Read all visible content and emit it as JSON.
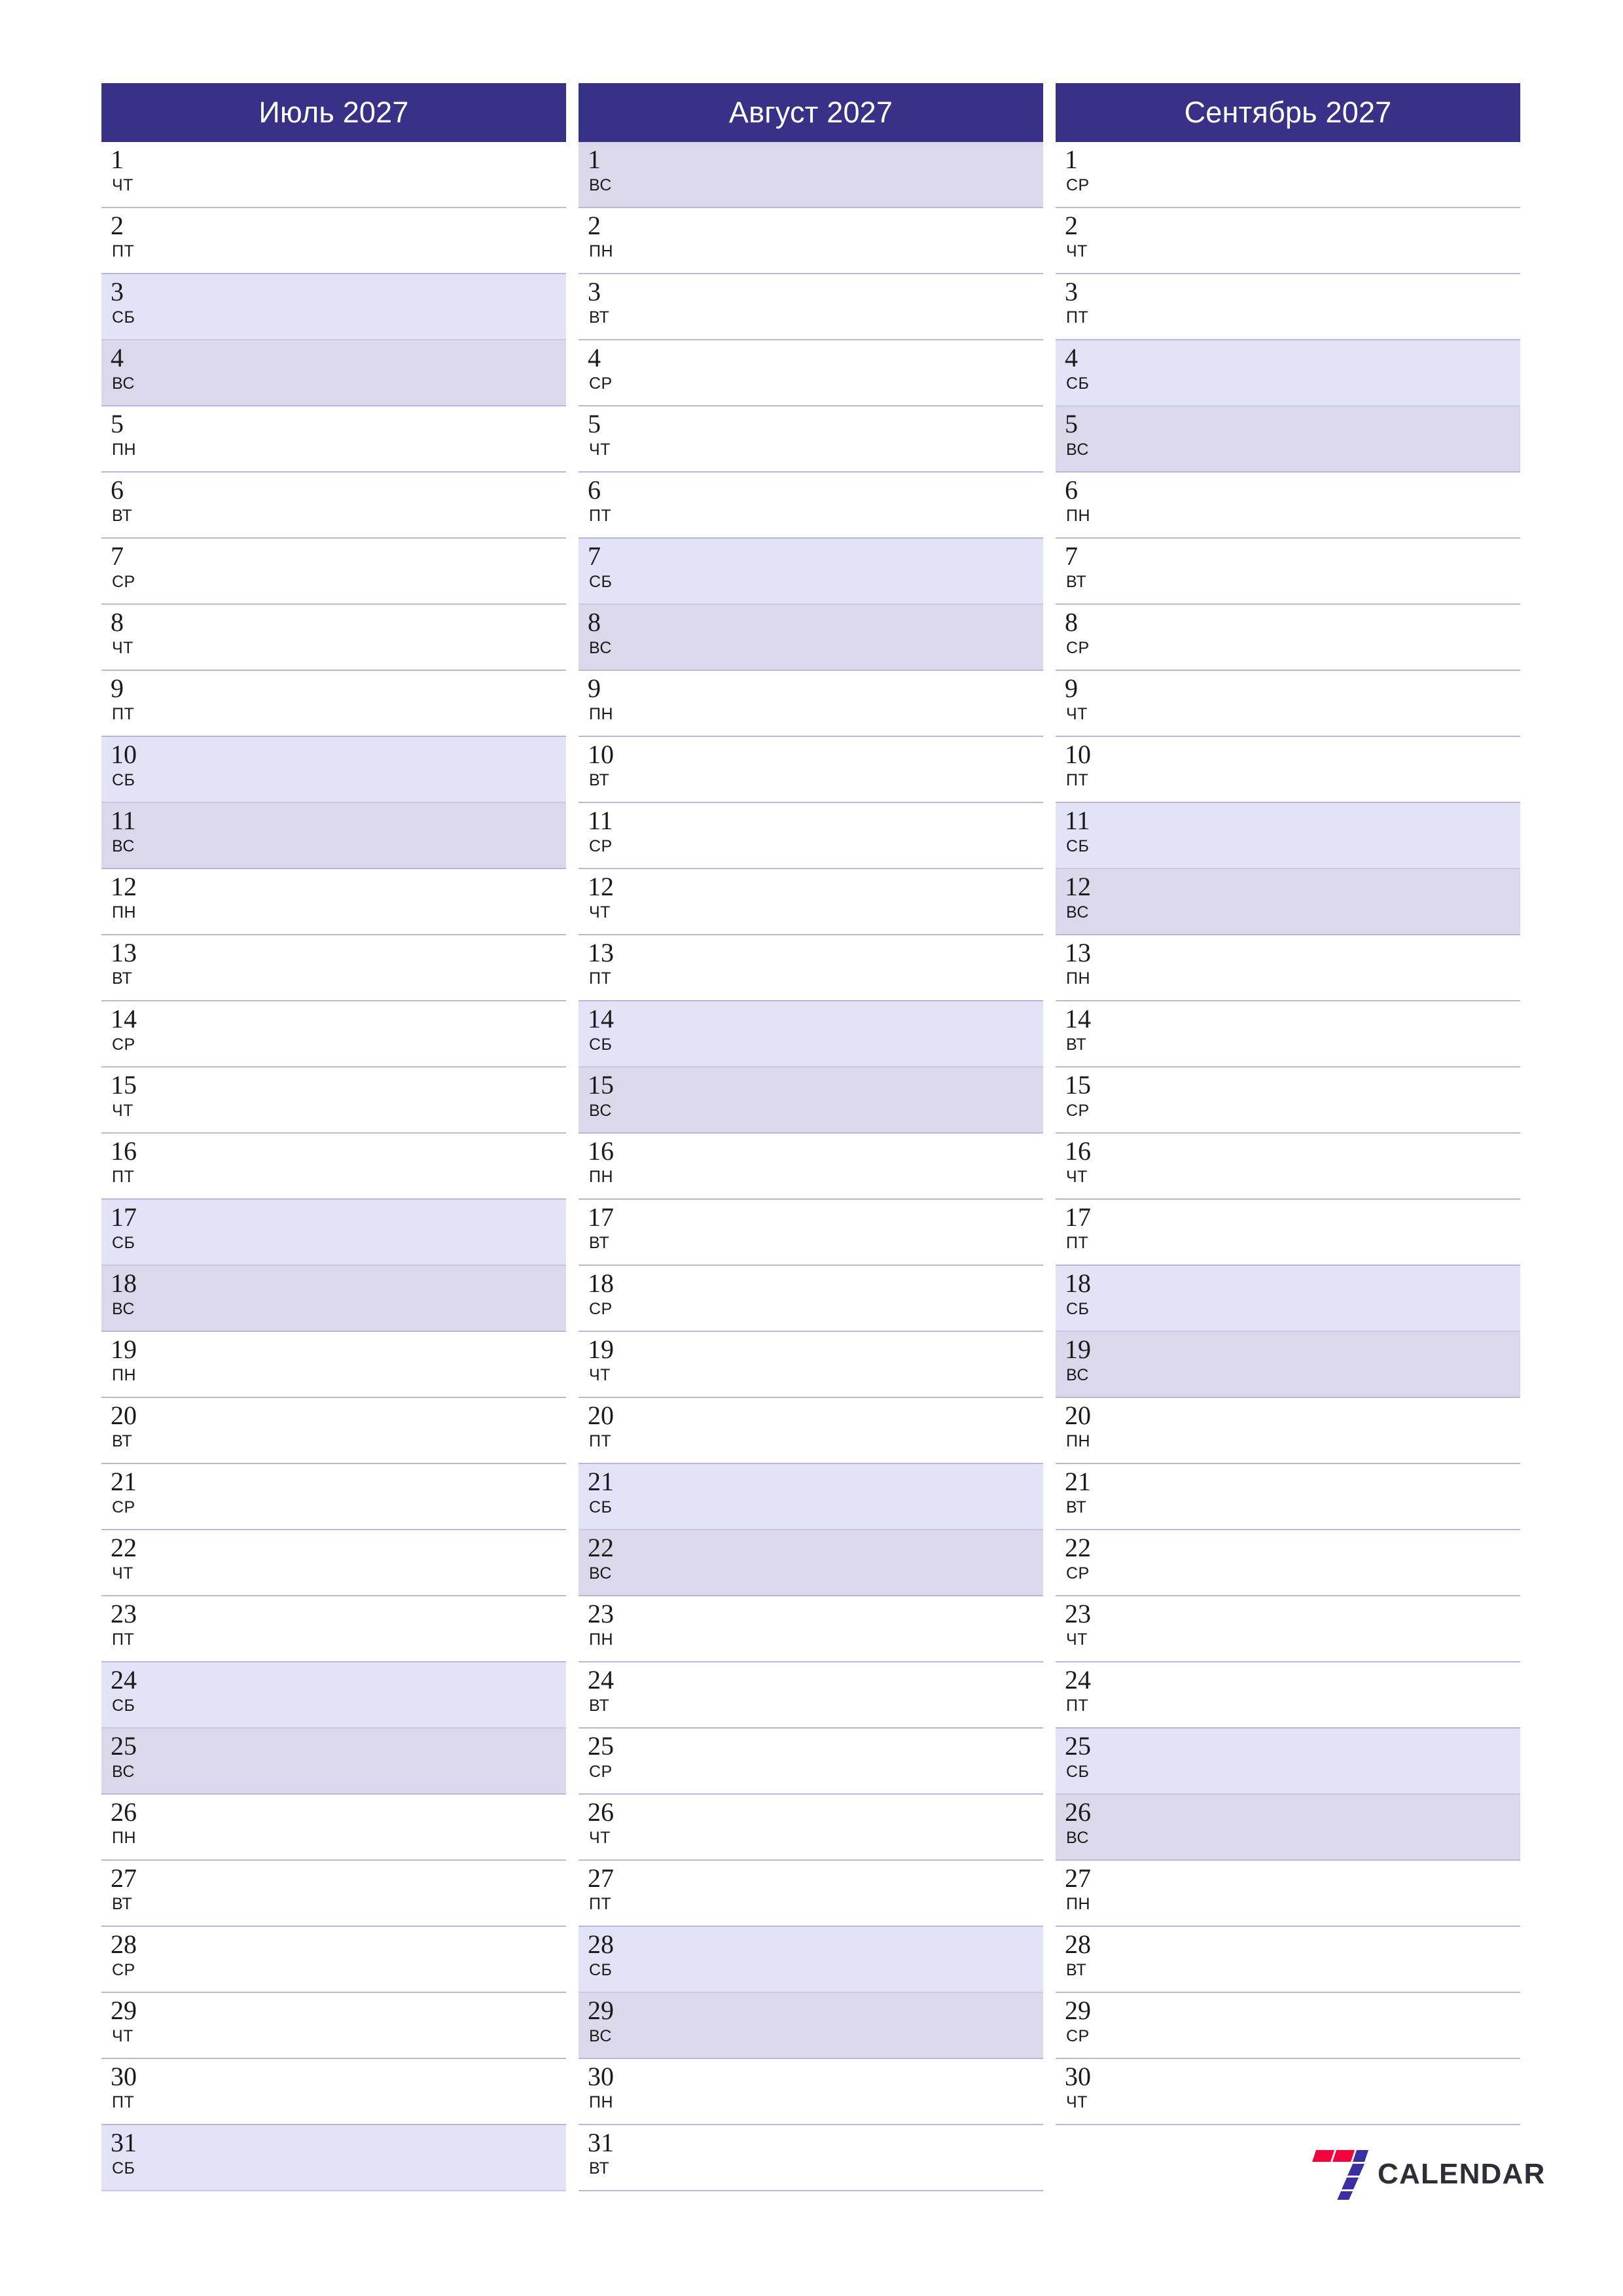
{
  "page": {
    "type": "quarterly-planner",
    "year": "2027",
    "background_color": "#ffffff",
    "header_color": "#393088",
    "saturday_color": "#e3e2f6",
    "sunday_color": "#dcd8ec",
    "grid_line_color": "#b9b7d8",
    "text_color": "#1a1a1a"
  },
  "brand": {
    "name": "CALENDAR",
    "logo_digit": "7",
    "logo_colors": [
      "#f5003c",
      "#3a2fa0"
    ],
    "text_color": "#2e2e36"
  },
  "months": [
    {
      "title": "Июль 2027",
      "days": [
        {
          "num": "1",
          "dow": "ЧТ",
          "type": "weekday"
        },
        {
          "num": "2",
          "dow": "ПТ",
          "type": "weekday"
        },
        {
          "num": "3",
          "dow": "СБ",
          "type": "sat"
        },
        {
          "num": "4",
          "dow": "ВС",
          "type": "sun"
        },
        {
          "num": "5",
          "dow": "ПН",
          "type": "weekday"
        },
        {
          "num": "6",
          "dow": "ВТ",
          "type": "weekday"
        },
        {
          "num": "7",
          "dow": "СР",
          "type": "weekday"
        },
        {
          "num": "8",
          "dow": "ЧТ",
          "type": "weekday"
        },
        {
          "num": "9",
          "dow": "ПТ",
          "type": "weekday"
        },
        {
          "num": "10",
          "dow": "СБ",
          "type": "sat"
        },
        {
          "num": "11",
          "dow": "ВС",
          "type": "sun"
        },
        {
          "num": "12",
          "dow": "ПН",
          "type": "weekday"
        },
        {
          "num": "13",
          "dow": "ВТ",
          "type": "weekday"
        },
        {
          "num": "14",
          "dow": "СР",
          "type": "weekday"
        },
        {
          "num": "15",
          "dow": "ЧТ",
          "type": "weekday"
        },
        {
          "num": "16",
          "dow": "ПТ",
          "type": "weekday"
        },
        {
          "num": "17",
          "dow": "СБ",
          "type": "sat"
        },
        {
          "num": "18",
          "dow": "ВС",
          "type": "sun"
        },
        {
          "num": "19",
          "dow": "ПН",
          "type": "weekday"
        },
        {
          "num": "20",
          "dow": "ВТ",
          "type": "weekday"
        },
        {
          "num": "21",
          "dow": "СР",
          "type": "weekday"
        },
        {
          "num": "22",
          "dow": "ЧТ",
          "type": "weekday"
        },
        {
          "num": "23",
          "dow": "ПТ",
          "type": "weekday"
        },
        {
          "num": "24",
          "dow": "СБ",
          "type": "sat"
        },
        {
          "num": "25",
          "dow": "ВС",
          "type": "sun"
        },
        {
          "num": "26",
          "dow": "ПН",
          "type": "weekday"
        },
        {
          "num": "27",
          "dow": "ВТ",
          "type": "weekday"
        },
        {
          "num": "28",
          "dow": "СР",
          "type": "weekday"
        },
        {
          "num": "29",
          "dow": "ЧТ",
          "type": "weekday"
        },
        {
          "num": "30",
          "dow": "ПТ",
          "type": "weekday"
        },
        {
          "num": "31",
          "dow": "СБ",
          "type": "sat"
        }
      ]
    },
    {
      "title": "Август 2027",
      "days": [
        {
          "num": "1",
          "dow": "ВС",
          "type": "sun"
        },
        {
          "num": "2",
          "dow": "ПН",
          "type": "weekday"
        },
        {
          "num": "3",
          "dow": "ВТ",
          "type": "weekday"
        },
        {
          "num": "4",
          "dow": "СР",
          "type": "weekday"
        },
        {
          "num": "5",
          "dow": "ЧТ",
          "type": "weekday"
        },
        {
          "num": "6",
          "dow": "ПТ",
          "type": "weekday"
        },
        {
          "num": "7",
          "dow": "СБ",
          "type": "sat"
        },
        {
          "num": "8",
          "dow": "ВС",
          "type": "sun"
        },
        {
          "num": "9",
          "dow": "ПН",
          "type": "weekday"
        },
        {
          "num": "10",
          "dow": "ВТ",
          "type": "weekday"
        },
        {
          "num": "11",
          "dow": "СР",
          "type": "weekday"
        },
        {
          "num": "12",
          "dow": "ЧТ",
          "type": "weekday"
        },
        {
          "num": "13",
          "dow": "ПТ",
          "type": "weekday"
        },
        {
          "num": "14",
          "dow": "СБ",
          "type": "sat"
        },
        {
          "num": "15",
          "dow": "ВС",
          "type": "sun"
        },
        {
          "num": "16",
          "dow": "ПН",
          "type": "weekday"
        },
        {
          "num": "17",
          "dow": "ВТ",
          "type": "weekday"
        },
        {
          "num": "18",
          "dow": "СР",
          "type": "weekday"
        },
        {
          "num": "19",
          "dow": "ЧТ",
          "type": "weekday"
        },
        {
          "num": "20",
          "dow": "ПТ",
          "type": "weekday"
        },
        {
          "num": "21",
          "dow": "СБ",
          "type": "sat"
        },
        {
          "num": "22",
          "dow": "ВС",
          "type": "sun"
        },
        {
          "num": "23",
          "dow": "ПН",
          "type": "weekday"
        },
        {
          "num": "24",
          "dow": "ВТ",
          "type": "weekday"
        },
        {
          "num": "25",
          "dow": "СР",
          "type": "weekday"
        },
        {
          "num": "26",
          "dow": "ЧТ",
          "type": "weekday"
        },
        {
          "num": "27",
          "dow": "ПТ",
          "type": "weekday"
        },
        {
          "num": "28",
          "dow": "СБ",
          "type": "sat"
        },
        {
          "num": "29",
          "dow": "ВС",
          "type": "sun"
        },
        {
          "num": "30",
          "dow": "ПН",
          "type": "weekday"
        },
        {
          "num": "31",
          "dow": "ВТ",
          "type": "weekday"
        }
      ]
    },
    {
      "title": "Сентябрь 2027",
      "days": [
        {
          "num": "1",
          "dow": "СР",
          "type": "weekday"
        },
        {
          "num": "2",
          "dow": "ЧТ",
          "type": "weekday"
        },
        {
          "num": "3",
          "dow": "ПТ",
          "type": "weekday"
        },
        {
          "num": "4",
          "dow": "СБ",
          "type": "sat"
        },
        {
          "num": "5",
          "dow": "ВС",
          "type": "sun"
        },
        {
          "num": "6",
          "dow": "ПН",
          "type": "weekday"
        },
        {
          "num": "7",
          "dow": "ВТ",
          "type": "weekday"
        },
        {
          "num": "8",
          "dow": "СР",
          "type": "weekday"
        },
        {
          "num": "9",
          "dow": "ЧТ",
          "type": "weekday"
        },
        {
          "num": "10",
          "dow": "ПТ",
          "type": "weekday"
        },
        {
          "num": "11",
          "dow": "СБ",
          "type": "sat"
        },
        {
          "num": "12",
          "dow": "ВС",
          "type": "sun"
        },
        {
          "num": "13",
          "dow": "ПН",
          "type": "weekday"
        },
        {
          "num": "14",
          "dow": "ВТ",
          "type": "weekday"
        },
        {
          "num": "15",
          "dow": "СР",
          "type": "weekday"
        },
        {
          "num": "16",
          "dow": "ЧТ",
          "type": "weekday"
        },
        {
          "num": "17",
          "dow": "ПТ",
          "type": "weekday"
        },
        {
          "num": "18",
          "dow": "СБ",
          "type": "sat"
        },
        {
          "num": "19",
          "dow": "ВС",
          "type": "sun"
        },
        {
          "num": "20",
          "dow": "ПН",
          "type": "weekday"
        },
        {
          "num": "21",
          "dow": "ВТ",
          "type": "weekday"
        },
        {
          "num": "22",
          "dow": "СР",
          "type": "weekday"
        },
        {
          "num": "23",
          "dow": "ЧТ",
          "type": "weekday"
        },
        {
          "num": "24",
          "dow": "ПТ",
          "type": "weekday"
        },
        {
          "num": "25",
          "dow": "СБ",
          "type": "sat"
        },
        {
          "num": "26",
          "dow": "ВС",
          "type": "sun"
        },
        {
          "num": "27",
          "dow": "ПН",
          "type": "weekday"
        },
        {
          "num": "28",
          "dow": "ВТ",
          "type": "weekday"
        },
        {
          "num": "29",
          "dow": "СР",
          "type": "weekday"
        },
        {
          "num": "30",
          "dow": "ЧТ",
          "type": "weekday"
        }
      ]
    }
  ]
}
